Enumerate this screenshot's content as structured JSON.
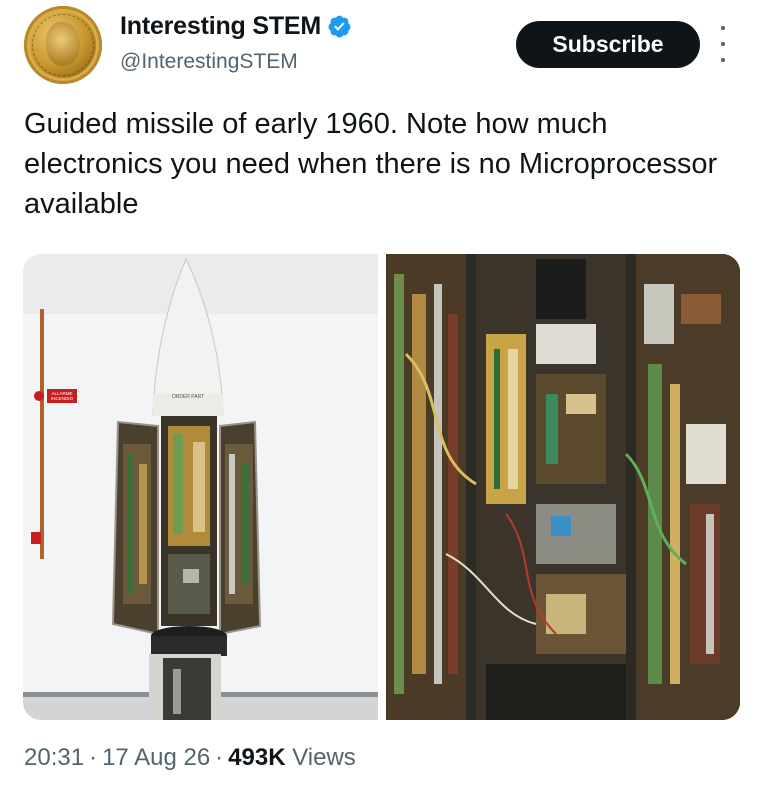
{
  "account": {
    "name": "Interesting STEM",
    "handle": "@InterestingSTEM",
    "verified_icon": "verified-badge-icon",
    "avatar_icon": "medal-avatar"
  },
  "actions": {
    "subscribe_label": "Subscribe",
    "more_icon": "more-vertical-icon"
  },
  "tweet": {
    "text": "Guided missile of early 1960. Note how much electronics you need when there is no Microprocessor available"
  },
  "media": {
    "photos": [
      {
        "name": "missile-photo-exterior",
        "label_text": "ALLARME INCENDIO"
      },
      {
        "name": "missile-photo-closeup"
      }
    ]
  },
  "meta": {
    "time": "20:31",
    "date": "17 Aug 26",
    "views_count": "493K",
    "views_label": "Views",
    "separator": "·"
  },
  "colors": {
    "text_primary": "#0f1419",
    "text_secondary": "#536471",
    "verified_blue": "#1d9bf0",
    "button_bg": "#0f1419"
  }
}
